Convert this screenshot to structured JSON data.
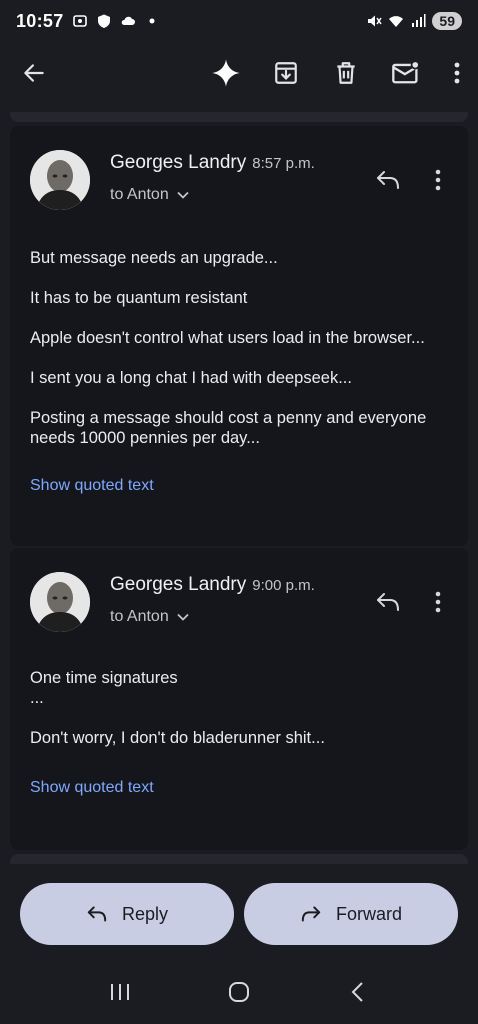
{
  "status_bar": {
    "time": "10:57",
    "battery": "59"
  },
  "toolbar": {
    "icons": [
      "back-arrow-icon",
      "sparkle-icon",
      "archive-icon",
      "delete-icon",
      "mark-unread-icon",
      "more-vert-icon"
    ]
  },
  "messages": [
    {
      "sender": "Georges Landry",
      "time": "8:57 p.m.",
      "recipient": "to Anton",
      "body": [
        "But message needs an upgrade...",
        "It has to be quantum resistant",
        "Apple doesn't control what users load in the browser...",
        "I sent you a long chat I had with deepseek...",
        "Posting a message should cost a penny and everyone needs 10000 pennies per day..."
      ],
      "quoted_label": "Show quoted text"
    },
    {
      "sender": "Georges Landry",
      "time": "9:00 p.m.",
      "recipient": "to Anton",
      "body": [
        "One time signatures\n...",
        "Don't worry, I don't do bladerunner shit..."
      ],
      "quoted_label": "Show quoted text"
    }
  ],
  "actions": {
    "reply_label": "Reply",
    "forward_label": "Forward"
  },
  "colors": {
    "background": "#1b1c22",
    "card": "#15161b",
    "link": "#7ea8ff",
    "action_button": "#c9cde4"
  }
}
